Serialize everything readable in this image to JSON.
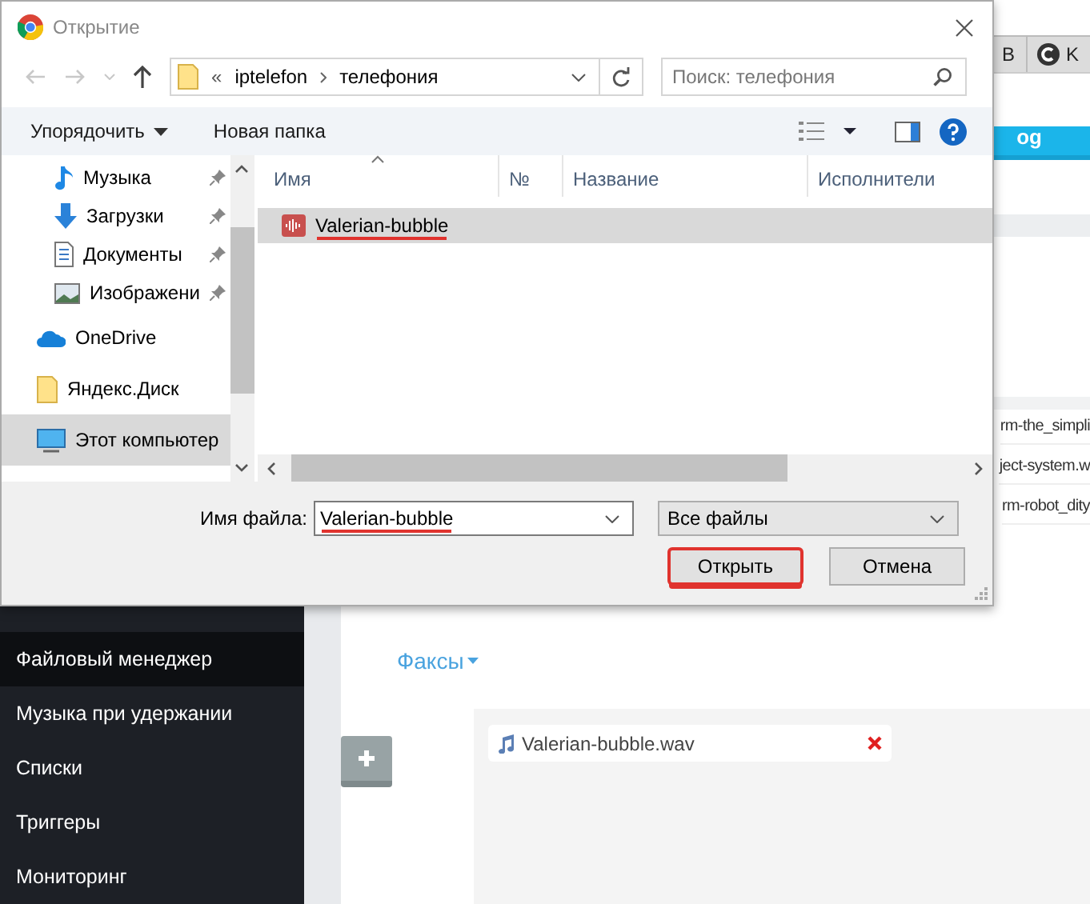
{
  "browser": {
    "tabs": [
      {
        "label": "B",
        "kind": "plain"
      },
      {
        "label": "K",
        "kind": "app"
      }
    ],
    "banner_text": "og"
  },
  "sidebar": {
    "items": [
      {
        "label": "Файловый менеджер",
        "selected": true
      },
      {
        "label": "Музыка при удержании",
        "selected": false
      },
      {
        "label": "Списки",
        "selected": false
      },
      {
        "label": "Триггеры",
        "selected": false
      },
      {
        "label": "Мониторинг",
        "selected": false
      }
    ]
  },
  "content": {
    "list_rows": [
      "rm-the_simpli",
      "ject-system.w",
      "rm-robot_dity"
    ],
    "fax_menu": "Факсы",
    "files": [
      {
        "name": "Valerian-bubble.wav"
      }
    ]
  },
  "dialog": {
    "title": "Открытие",
    "breadcrumb": {
      "overflow": "«",
      "items": [
        "iptelefon",
        "телефония"
      ]
    },
    "search": {
      "placeholder": "Поиск: телефония"
    },
    "toolbar": {
      "organize": "Упорядочить",
      "new_folder": "Новая папка"
    },
    "nav_items": [
      {
        "label": "Музыка",
        "kind": "quick",
        "pinned": true,
        "selected": false
      },
      {
        "label": "Загрузки",
        "kind": "quick",
        "pinned": true,
        "selected": false
      },
      {
        "label": "Документы",
        "kind": "quick",
        "pinned": true,
        "selected": false
      },
      {
        "label": "Изображени",
        "kind": "quick",
        "pinned": true,
        "selected": false
      },
      {
        "label": "OneDrive",
        "kind": "root",
        "pinned": false,
        "selected": false
      },
      {
        "label": "Яндекс.Диск",
        "kind": "root",
        "pinned": false,
        "selected": false
      },
      {
        "label": "Этот компьютер",
        "kind": "root",
        "pinned": false,
        "selected": true
      }
    ],
    "columns": [
      {
        "label": "Имя",
        "sorted": true
      },
      {
        "label": "№",
        "sorted": false
      },
      {
        "label": "Название",
        "sorted": false
      },
      {
        "label": "Исполнители",
        "sorted": false
      }
    ],
    "files": [
      {
        "name": "Valerian-bubble",
        "selected": true,
        "marked": true
      }
    ],
    "filename": {
      "label": "Имя файла:",
      "value": "Valerian-bubble",
      "marked": true
    },
    "filter": {
      "value": "Все файлы"
    },
    "buttons": [
      {
        "label": "Открыть",
        "marked": true
      },
      {
        "label": "Отмена",
        "marked": false
      }
    ]
  }
}
